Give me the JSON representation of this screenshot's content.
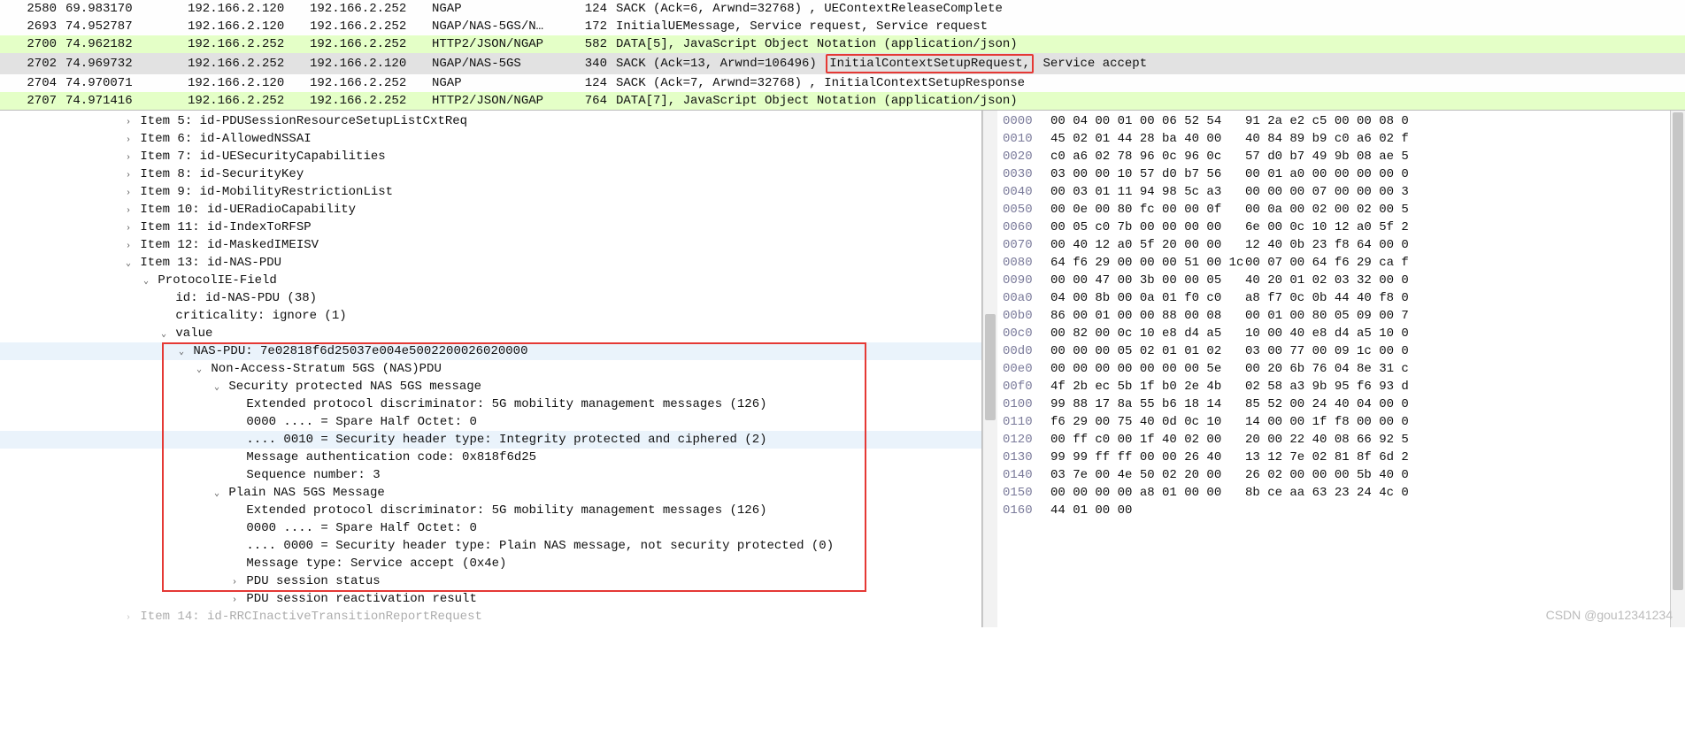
{
  "packets": [
    {
      "no": "2580",
      "time": "69.983170",
      "src": "192.166.2.120",
      "dst": "192.166.2.252",
      "proto": "NGAP",
      "len": "124",
      "info": "SACK (Ack=6, Arwnd=32768) , UEContextReleaseComplete",
      "cls": "row-white"
    },
    {
      "no": "2693",
      "time": "74.952787",
      "src": "192.166.2.120",
      "dst": "192.166.2.252",
      "proto": "NGAP/NAS-5GS/N…",
      "len": "172",
      "info": "InitialUEMessage, Service request, Service request",
      "cls": "row-white"
    },
    {
      "no": "2700",
      "time": "74.962182",
      "src": "192.166.2.252",
      "dst": "192.166.2.252",
      "proto": "HTTP2/JSON/NGAP",
      "len": "582",
      "info": "DATA[5], JavaScript Object Notation (application/json)",
      "cls": "row-green"
    },
    {
      "no": "2702",
      "time": "74.969732",
      "src": "192.166.2.252",
      "dst": "192.166.2.120",
      "proto": "NGAP/NAS-5GS",
      "len": "340",
      "info_pre": "SACK (Ack=13, Arwnd=106496) ",
      "info_hl": " InitialContextSetupRequest,",
      "info_post": " Service accept",
      "cls": "row-sel",
      "hl": true
    },
    {
      "no": "2704",
      "time": "74.970071",
      "src": "192.166.2.120",
      "dst": "192.166.2.252",
      "proto": "NGAP",
      "len": "124",
      "info": "SACK (Ack=7, Arwnd=32768) , InitialContextSetupResponse",
      "cls": "row-white"
    },
    {
      "no": "2707",
      "time": "74.971416",
      "src": "192.166.2.252",
      "dst": "192.166.2.252",
      "proto": "HTTP2/JSON/NGAP",
      "len": "764",
      "info": "DATA[7], JavaScript Object Notation (application/json)",
      "cls": "row-green"
    }
  ],
  "tree": [
    {
      "ind": 7,
      "tog": ">",
      "txt": "Item 5: id-PDUSessionResourceSetupListCxtReq"
    },
    {
      "ind": 7,
      "tog": ">",
      "txt": "Item 6: id-AllowedNSSAI"
    },
    {
      "ind": 7,
      "tog": ">",
      "txt": "Item 7: id-UESecurityCapabilities"
    },
    {
      "ind": 7,
      "tog": ">",
      "txt": "Item 8: id-SecurityKey"
    },
    {
      "ind": 7,
      "tog": ">",
      "txt": "Item 9: id-MobilityRestrictionList"
    },
    {
      "ind": 7,
      "tog": ">",
      "txt": "Item 10: id-UERadioCapability"
    },
    {
      "ind": 7,
      "tog": ">",
      "txt": "Item 11: id-IndexToRFSP"
    },
    {
      "ind": 7,
      "tog": ">",
      "txt": "Item 12: id-MaskedIMEISV"
    },
    {
      "ind": 7,
      "tog": "v",
      "txt": "Item 13: id-NAS-PDU"
    },
    {
      "ind": 8,
      "tog": "v",
      "txt": "ProtocolIE-Field"
    },
    {
      "ind": 9,
      "tog": "",
      "txt": "id: id-NAS-PDU (38)"
    },
    {
      "ind": 9,
      "tog": "",
      "txt": "criticality: ignore (1)"
    },
    {
      "ind": 9,
      "tog": "v",
      "txt": "value"
    },
    {
      "ind": 10,
      "tog": "v",
      "txt": "NAS-PDU: 7e02818f6d25037e004e5002200026020000",
      "sel": true
    },
    {
      "ind": 11,
      "tog": "v",
      "txt": "Non-Access-Stratum 5GS (NAS)PDU"
    },
    {
      "ind": 12,
      "tog": "v",
      "txt": "Security protected NAS 5GS message"
    },
    {
      "ind": 13,
      "tog": "",
      "txt": "Extended protocol discriminator: 5G mobility management messages (126)"
    },
    {
      "ind": 13,
      "tog": "",
      "txt": "0000 .... = Spare Half Octet: 0"
    },
    {
      "ind": 13,
      "tog": "",
      "txt": ".... 0010 = Security header type: Integrity protected and ciphered (2)",
      "sel": true
    },
    {
      "ind": 13,
      "tog": "",
      "txt": "Message authentication code: 0x818f6d25"
    },
    {
      "ind": 13,
      "tog": "",
      "txt": "Sequence number: 3"
    },
    {
      "ind": 12,
      "tog": "v",
      "txt": "Plain NAS 5GS Message"
    },
    {
      "ind": 13,
      "tog": "",
      "txt": "Extended protocol discriminator: 5G mobility management messages (126)"
    },
    {
      "ind": 13,
      "tog": "",
      "txt": "0000 .... = Spare Half Octet: 0"
    },
    {
      "ind": 13,
      "tog": "",
      "txt": ".... 0000 = Security header type: Plain NAS message, not security protected (0)"
    },
    {
      "ind": 13,
      "tog": "",
      "txt": "Message type: Service accept (0x4e)"
    },
    {
      "ind": 13,
      "tog": ">",
      "txt": "PDU session status"
    },
    {
      "ind": 13,
      "tog": ">",
      "txt": "PDU session reactivation result"
    },
    {
      "ind": 7,
      "tog": ">",
      "txt": "Item 14: id-RRCInactiveTransitionReportRequest",
      "fade": true
    }
  ],
  "hex": [
    {
      "o": "0000",
      "b1": "00 04 00 01 00 06 52 54",
      "b2": "91 2a e2 c5 00 00 08 0"
    },
    {
      "o": "0010",
      "b1": "45 02 01 44 28 ba 40 00",
      "b2": "40 84 89 b9 c0 a6 02 f"
    },
    {
      "o": "0020",
      "b1": "c0 a6 02 78 96 0c 96 0c",
      "b2": "57 d0 b7 49 9b 08 ae 5"
    },
    {
      "o": "0030",
      "b1": "03 00 00 10 57 d0 b7 56",
      "b2": "00 01 a0 00 00 00 00 0"
    },
    {
      "o": "0040",
      "b1": "00 03 01 11 94 98 5c a3",
      "b2": "00 00 00 07 00 00 00 3"
    },
    {
      "o": "0050",
      "b1": "00 0e 00 80 fc 00 00 0f",
      "b2": "00 0a 00 02 00 02 00 5"
    },
    {
      "o": "0060",
      "b1": "00 05 c0 7b 00 00 00 00",
      "b2": "6e 00 0c 10 12 a0 5f 2"
    },
    {
      "o": "0070",
      "b1": "00 40 12 a0 5f 20 00 00",
      "b2": "12 40 0b 23 f8 64 00 0"
    },
    {
      "o": "0080",
      "b1": "64 f6 29 00 00 00 51 00 1c",
      "b2": "00 07 00 64 f6 29 ca f"
    },
    {
      "o": "0090",
      "b1": "00 00 47 00 3b 00 00 05",
      "b2": "40 20 01 02 03 32 00 0"
    },
    {
      "o": "00a0",
      "b1": "04 00 8b 00 0a 01 f0 c0",
      "b2": "a8 f7 0c 0b 44 40 f8 0"
    },
    {
      "o": "00b0",
      "b1": "86 00 01 00 00 88 00 08",
      "b2": "00 01 00 80 05 09 00 7"
    },
    {
      "o": "00c0",
      "b1": "00 82 00 0c 10 e8 d4 a5",
      "b2": "10 00 40 e8 d4 a5 10 0"
    },
    {
      "o": "00d0",
      "b1": "00 00 00 05 02 01 01 02",
      "b2": "03 00 77 00 09 1c 00 0"
    },
    {
      "o": "00e0",
      "b1": "00 00 00 00 00 00 00 5e",
      "b2": "00 20 6b 76 04 8e 31 c"
    },
    {
      "o": "00f0",
      "b1": "4f 2b ec 5b 1f b0 2e 4b",
      "b2": "02 58 a3 9b 95 f6 93 d"
    },
    {
      "o": "0100",
      "b1": "99 88 17 8a 55 b6 18 14",
      "b2": "85 52 00 24 40 04 00 0"
    },
    {
      "o": "0110",
      "b1": "f6 29 00 75 40 0d 0c 10",
      "b2": "14 00 00 1f f8 00 00 0"
    },
    {
      "o": "0120",
      "b1": "00 ff c0 00 1f 40 02 00",
      "b2": "20 00 22 40 08 66 92 5"
    },
    {
      "o": "0130",
      "b1": "99 99 ff ff 00 00 26 40",
      "b2": "13 12 7e 02 81 8f 6d 2"
    },
    {
      "o": "0140",
      "b1": "03 7e 00 4e 50 02 20 00",
      "b2": "26 02 00 00 00 5b 40 0"
    },
    {
      "o": "0150",
      "b1": "00 00 00 00 a8 01 00 00",
      "b2": "8b ce aa 63 23 24 4c 0"
    },
    {
      "o": "0160",
      "b1": "44 01 00 00",
      "b2": ""
    }
  ],
  "watermark": "CSDN @gou12341234"
}
